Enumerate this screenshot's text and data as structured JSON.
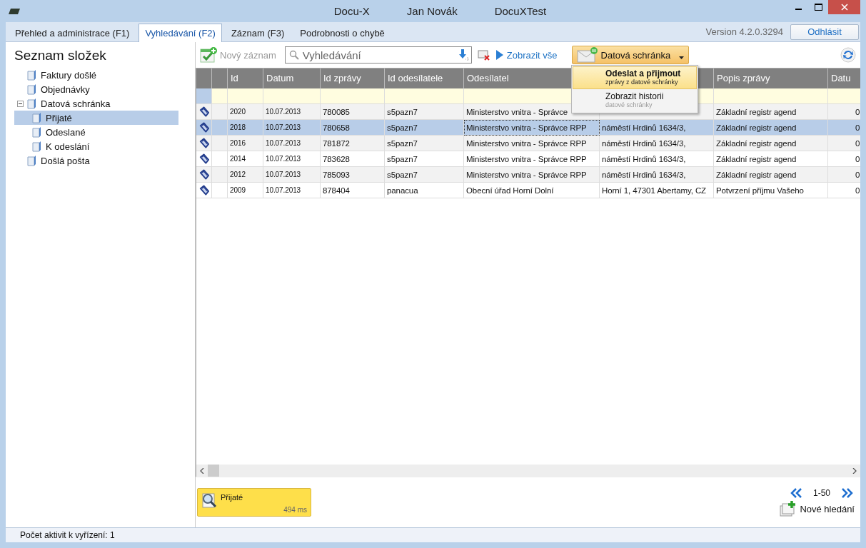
{
  "window": {
    "title_parts": [
      "Docu-X",
      "Jan Novák",
      "DocuXTest"
    ]
  },
  "tabs": [
    {
      "label": "Přehled a administrace (F1)",
      "selected": false
    },
    {
      "label": "Vyhledávání (F2)",
      "selected": true
    },
    {
      "label": "Záznam (F3)",
      "selected": false
    },
    {
      "label": "Podrobnosti o chybě",
      "selected": false
    }
  ],
  "version": "Version 4.2.0.3294",
  "logout_button": "Odhlásit",
  "sidebar": {
    "title": "Seznam složek",
    "items": [
      {
        "label": "Faktury došlé",
        "selected": false
      },
      {
        "label": "Objednávky",
        "selected": false
      },
      {
        "label": "Datová schránka",
        "selected": false,
        "expanded": true,
        "children": [
          {
            "label": "Přijaté",
            "selected": true
          },
          {
            "label": "Odeslané",
            "selected": false
          },
          {
            "label": "K odeslání",
            "selected": false
          }
        ]
      },
      {
        "label": "Došlá pošta",
        "selected": false
      }
    ]
  },
  "toolbar": {
    "new_record": "Nový záznam",
    "search": {
      "placeholder": "Vyhledávání"
    },
    "show_all": "Zobrazit vše",
    "mailbox_button": "Datová schránka"
  },
  "mailbox_menu": [
    {
      "title": "Odeslat a přijmout",
      "subtitle": "zprávy z datové schránky",
      "selected": true
    },
    {
      "title": "Zobrazit historii",
      "subtitle": "datové schránky",
      "selected": false
    }
  ],
  "table": {
    "columns": [
      {},
      {},
      {
        "label": "Id"
      },
      {
        "label": "Datum"
      },
      {
        "label": "Id zprávy"
      },
      {
        "label": "Id odesílatele"
      },
      {
        "label": "Odesílatel"
      },
      {},
      {
        "label": "Popis zprávy"
      },
      {
        "label": "Datu"
      }
    ],
    "rows": [
      {
        "selected": false,
        "cells": [
          "",
          "",
          "2020",
          "10.07.2013",
          "780085",
          "s5pazn7",
          "Ministerstvo vnitra - Správce",
          "",
          "Základní registr agend",
          "0"
        ]
      },
      {
        "selected": true,
        "cells": [
          "",
          "",
          "2018",
          "10.07.2013",
          "780658",
          "s5pazn7",
          "Ministerstvo vnitra - Správce RPP",
          "náměstí Hrdinů 1634/3,",
          "Základní registr agend",
          "0"
        ]
      },
      {
        "selected": false,
        "cells": [
          "",
          "",
          "2016",
          "10.07.2013",
          "781872",
          "s5pazn7",
          "Ministerstvo vnitra - Správce RPP",
          "náměstí Hrdinů 1634/3,",
          "Základní registr agend",
          "0"
        ]
      },
      {
        "selected": false,
        "cells": [
          "",
          "",
          "2014",
          "10.07.2013",
          "783628",
          "s5pazn7",
          "Ministerstvo vnitra - Správce RPP",
          "náměstí Hrdinů 1634/3,",
          "Základní registr agend",
          "0"
        ]
      },
      {
        "selected": false,
        "cells": [
          "",
          "",
          "2012",
          "10.07.2013",
          "785093",
          "s5pazn7",
          "Ministerstvo vnitra - Správce RPP",
          "náměstí Hrdinů 1634/3,",
          "Základní registr agend",
          "0"
        ]
      },
      {
        "selected": false,
        "cells": [
          "",
          "",
          "2009",
          "10.07.2013",
          "878404",
          "panacua",
          "Obecní úřad Horní Dolní",
          "Horní 1, 47301 Abertamy, CZ",
          "Potvrzení příjmu Vašeho",
          "0"
        ]
      }
    ]
  },
  "search_tile": {
    "label": "Přijaté",
    "time": "494 ms"
  },
  "pager": {
    "range": "1-50"
  },
  "new_search": "Nové hledání",
  "status_bar": "Počet aktivit k vyřízení: 1"
}
